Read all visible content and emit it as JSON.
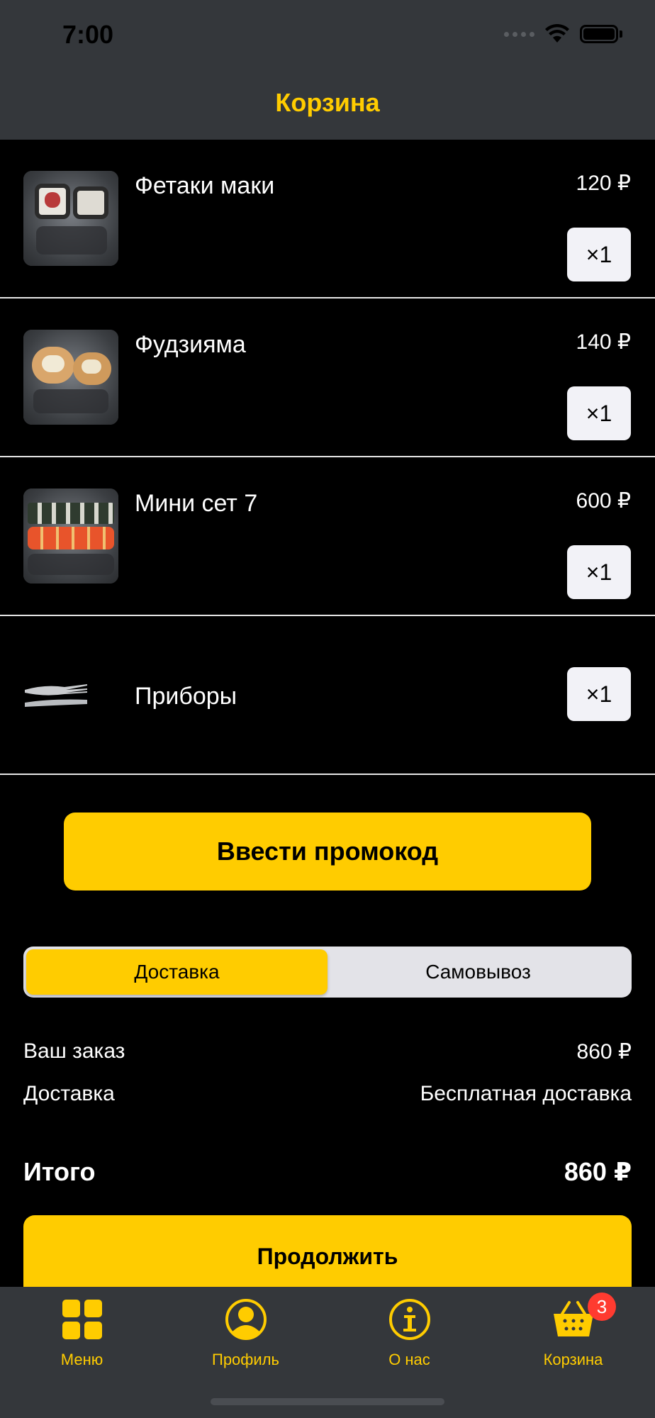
{
  "status_bar": {
    "time": "7:00"
  },
  "nav": {
    "title": "Корзина"
  },
  "cart": {
    "items": [
      {
        "name": "Фетаки маки",
        "price": "120 ₽",
        "qty": "×1"
      },
      {
        "name": "Фудзияма",
        "price": "140 ₽",
        "qty": "×1"
      },
      {
        "name": "Мини сет 7",
        "price": "600 ₽",
        "qty": "×1"
      }
    ],
    "cutlery": {
      "name": "Приборы",
      "qty": "×1"
    }
  },
  "promo": {
    "label": "Ввести промокод"
  },
  "delivery_toggle": {
    "options": [
      "Доставка",
      "Самовывоз"
    ],
    "selected": "Доставка"
  },
  "summary": {
    "order_label": "Ваш заказ",
    "order_value": "860 ₽",
    "delivery_label": "Доставка",
    "delivery_value": "Бесплатная доставка",
    "total_label": "Итого",
    "total_value": "860 ₽"
  },
  "continue": {
    "label": "Продолжить"
  },
  "tabbar": {
    "tabs": [
      {
        "label": "Меню",
        "icon": "grid-icon"
      },
      {
        "label": "Профиль",
        "icon": "profile-icon"
      },
      {
        "label": "О нас",
        "icon": "info-icon"
      },
      {
        "label": "Корзина",
        "icon": "basket-icon",
        "badge": "3"
      }
    ]
  },
  "colors": {
    "accent": "#ffcc00",
    "bar": "#34373b",
    "badge": "#ff3b30"
  }
}
